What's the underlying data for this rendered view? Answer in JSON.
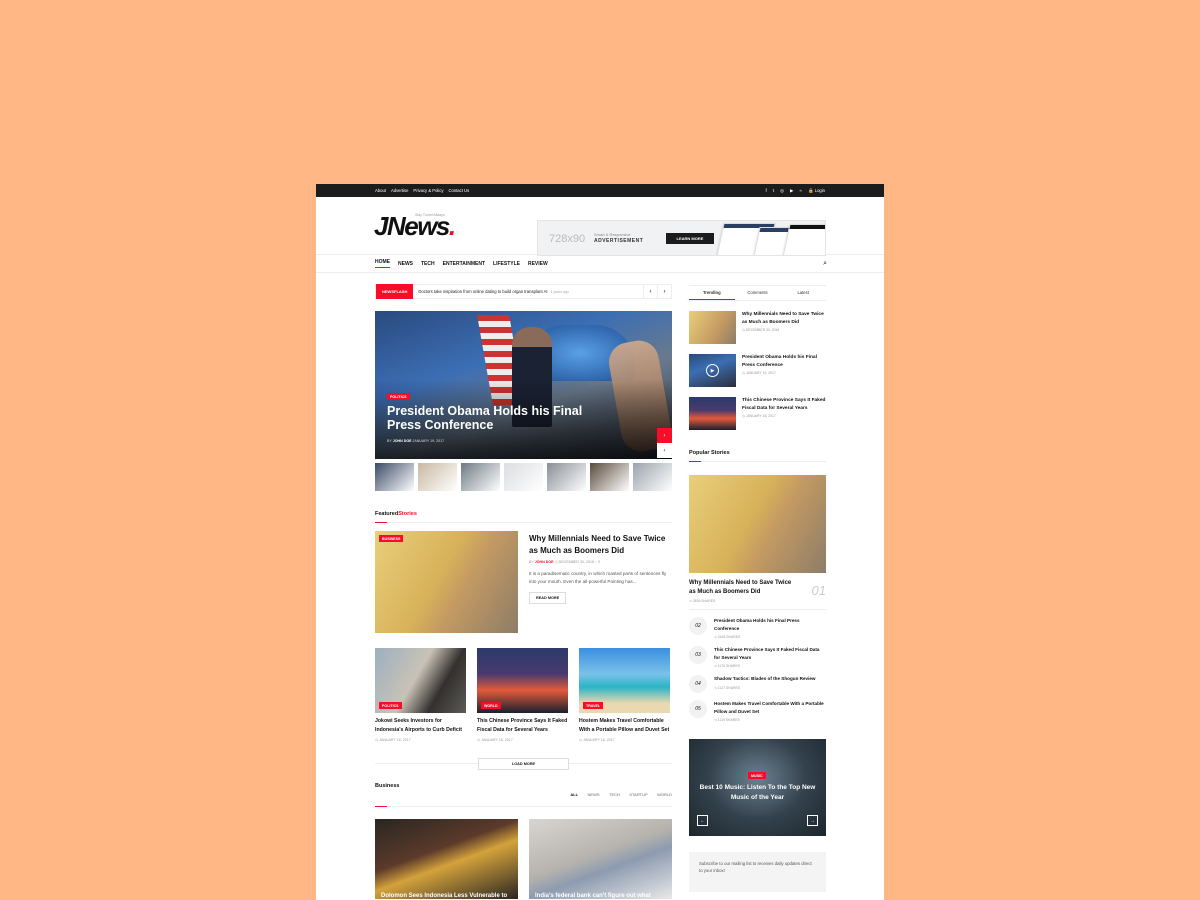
{
  "topbar": {
    "links": [
      "About",
      "Advertise",
      "Privacy & Policy",
      "Contact Us"
    ],
    "social_icons": [
      "facebook-icon",
      "twitter-icon",
      "instagram-icon",
      "youtube-icon",
      "rss-icon"
    ],
    "login": "Login"
  },
  "header": {
    "logo": "JNews",
    "logo_dot": ".",
    "tagline": "Stay Tuned Always",
    "ad": {
      "size": "728x90",
      "small": "Smart & Responsive",
      "big": "ADVERTISEMENT",
      "button": "LEARN MORE"
    }
  },
  "nav": {
    "items": [
      "HOME",
      "NEWS",
      "TECH",
      "ENTERTAINMENT",
      "LIFESTYLE",
      "REVIEW"
    ]
  },
  "newsflash": {
    "label": "NEWSFLASH",
    "text": "Doctors take inspiration from online dating to build organ transplant AI",
    "time": "4 years ago"
  },
  "hero": {
    "category": "POLITICS",
    "title": "President Obama Holds his Final Press Conference",
    "by": "BY",
    "author": "JOHN DOE",
    "date": "JANUARY 19, 2017",
    "thumb_colors": [
      "#3a4a66",
      "#c9b9a1",
      "#6f7a85",
      "#dcdde0",
      "#8a8f96",
      "#5b4a3c",
      "#9aa3ad"
    ]
  },
  "featured": {
    "section_black": "Featured",
    "section_red": "Stories",
    "category": "BUSINESS",
    "title": "Why Millennials Need to Save Twice as Much as Boomers Did",
    "by": "BY",
    "author": "JOHN DOE",
    "date": "DECEMBER 30, 2016",
    "comments": "0",
    "excerpt": "It is a paradisematic country, in which roasted parts of sentences fly into your mouth. Even the all-powerful Pointing has...",
    "readmore": "READ MORE"
  },
  "grid": [
    {
      "category": "POLITICS",
      "title": "Jokowi Seeks Investors for Indonesia's Airports to Curb Deficit",
      "date": "JANUARY 18, 2017"
    },
    {
      "category": "WORLD",
      "title": "This Chinese Province Says It Faked Fiscal Data for Several Years",
      "date": "JANUARY 18, 2017"
    },
    {
      "category": "TRAVEL",
      "title": "Hostem Makes Travel Comfortable With a Portable Pillow and Duvet Set",
      "date": "JANUARY 18, 2017"
    }
  ],
  "loadmore": "LOAD MORE",
  "business": {
    "title": "Business",
    "tabs": [
      "ALL",
      "NEWS",
      "TECH",
      "STARTUP",
      "WORLD"
    ],
    "cards": [
      "Dolomon Sees Indonesia Less Vulnerable to",
      "India's federal bank can't figure out what"
    ]
  },
  "sidebar": {
    "tabs": [
      "Trending",
      "Comments",
      "Latest"
    ],
    "trending": [
      {
        "title": "Why Millennials Need to Save Twice as Much as Boomers Did",
        "date": "DECEMBER 30, 2016"
      },
      {
        "title": "President Obama Holds his Final Press Conference",
        "date": "JANUARY 19, 2017"
      },
      {
        "title": "This Chinese Province Says It Faked Fiscal Data for Several Years",
        "date": "JANUARY 18, 2017"
      }
    ],
    "popular_title": "Popular Stories",
    "popular_first": {
      "title": "Why Millennials Need to Save Twice as Much as Boomers Did",
      "num": "01",
      "shares": "2835 SHARES"
    },
    "popular": [
      {
        "num": "02",
        "title": "President Obama Holds his Final Press Conference",
        "shares": "2446 SHARES"
      },
      {
        "num": "03",
        "title": "This Chinese Province Says It Faked Fiscal Data for Several Years",
        "shares": "1175 SHARES"
      },
      {
        "num": "04",
        "title": "Shadow Tactics: Blades of the Shogun Review",
        "shares": "1127 SHARES"
      },
      {
        "num": "05",
        "title": "Hostem Makes Travel Comfortable With a Portable Pillow and Duvet Set",
        "shares": "1119 SHARES"
      }
    ],
    "music": {
      "category": "MUSIC",
      "title": "Best 10 Music: Listen To the Top New Music of the Year"
    },
    "subscribe": "Subscribe to our mailing list to receives daily updates direct to your inbox!"
  },
  "colors": {
    "accent": "#f70d28",
    "background": "#ffb885",
    "topbar": "#1c1c1c"
  }
}
